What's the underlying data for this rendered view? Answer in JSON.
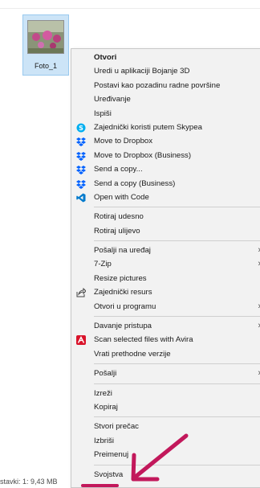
{
  "file": {
    "name": "Foto_1"
  },
  "status_bar": {
    "text": "stavki: 1: 9,43 MB"
  },
  "menu": {
    "items": [
      {
        "label": "Otvori",
        "bold": true
      },
      {
        "label": "Uredi u aplikaciji Bojanje 3D"
      },
      {
        "label": "Postavi kao pozadinu radne površine"
      },
      {
        "label": "Uređivanje"
      },
      {
        "label": "Ispiši"
      },
      {
        "label": "Zajednički koristi putem Skypea",
        "icon": "skype-icon"
      },
      {
        "label": "Move to Dropbox",
        "icon": "dropbox-icon"
      },
      {
        "label": "Move to Dropbox (Business)",
        "icon": "dropbox-icon"
      },
      {
        "label": "Send a copy...",
        "icon": "dropbox-icon"
      },
      {
        "label": "Send a copy (Business)",
        "icon": "dropbox-icon"
      },
      {
        "label": "Open with Code",
        "icon": "vscode-icon"
      },
      {
        "label": "Rotiraj udesno"
      },
      {
        "label": "Rotiraj ulijevo"
      },
      {
        "label": "Pošalji na uređaj",
        "submenu": true
      },
      {
        "label": "7-Zip",
        "submenu": true
      },
      {
        "label": "Resize pictures"
      },
      {
        "label": "Zajednički resurs",
        "icon": "share-icon"
      },
      {
        "label": "Otvori u programu",
        "submenu": true
      },
      {
        "label": "Davanje pristupa",
        "submenu": true
      },
      {
        "label": "Scan selected files with Avira",
        "icon": "avira-icon"
      },
      {
        "label": "Vrati prethodne verzije"
      },
      {
        "label": "Pošalji",
        "submenu": true
      },
      {
        "label": "Izreži"
      },
      {
        "label": "Kopiraj"
      },
      {
        "label": "Stvori prečac"
      },
      {
        "label": "Izbriši"
      },
      {
        "label": "Preimenuj"
      },
      {
        "label": "Svojstva"
      }
    ]
  },
  "colors": {
    "menu_bg": "#f2f2f2",
    "selection_bg": "#cce4f7",
    "annotation_arrow": "#c2185b",
    "skype": "#00aff0",
    "dropbox": "#0061ff",
    "vscode": "#007acc",
    "avira": "#d9142b"
  }
}
